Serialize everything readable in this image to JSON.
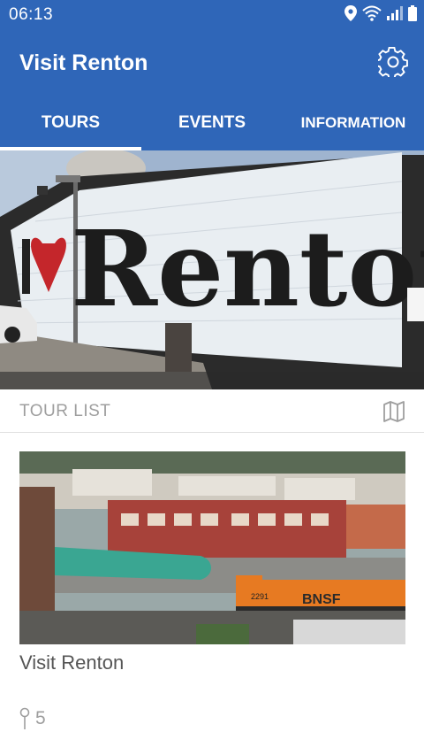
{
  "status": {
    "time": "06:13"
  },
  "app": {
    "title": "Visit Renton"
  },
  "tabs": [
    {
      "label": "TOURS"
    },
    {
      "label": "EVENTS"
    },
    {
      "label": "INFORMATION"
    }
  ],
  "hero": {
    "mural_text": "Renton"
  },
  "tour_list": {
    "heading": "TOUR LIST",
    "tours": [
      {
        "title": "Visit Renton",
        "stops": "5",
        "train_label": "BNSF",
        "train_number": "2291"
      }
    ]
  },
  "icons": {
    "settings": "gear-icon",
    "map": "map-icon",
    "stops": "pin-icon"
  },
  "colors": {
    "primary": "#2f66b8",
    "muted": "#9e9e9e"
  }
}
